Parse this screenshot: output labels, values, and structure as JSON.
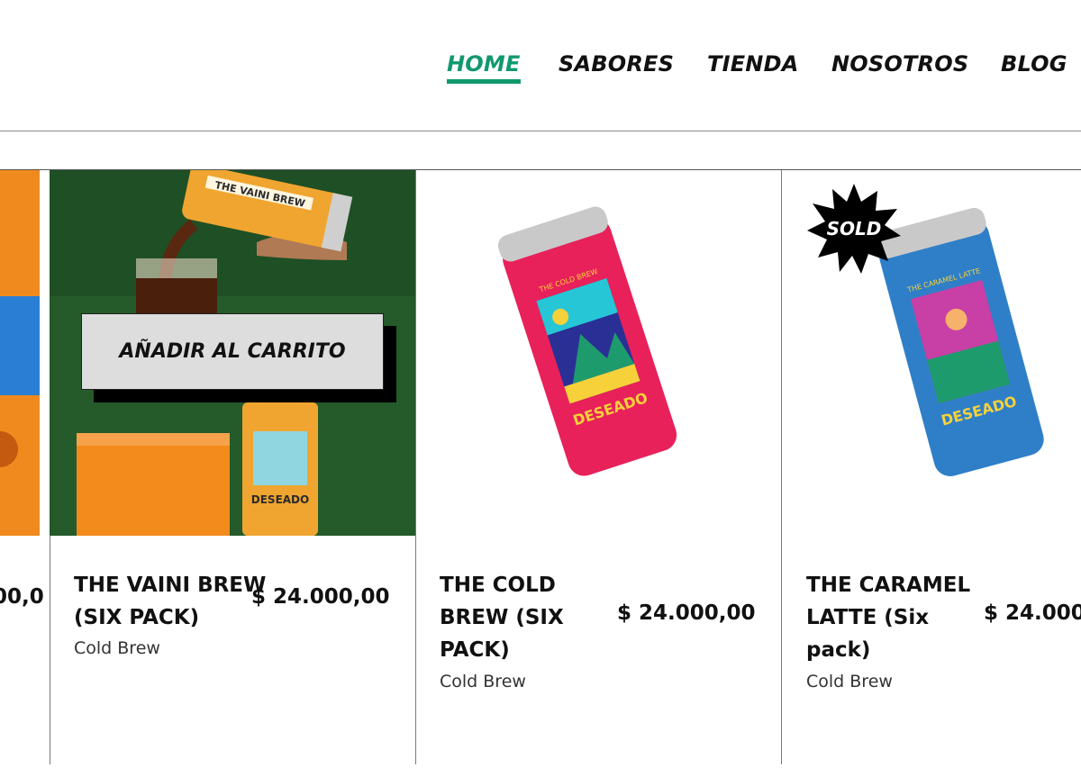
{
  "nav": {
    "items": [
      {
        "label": "HOME"
      },
      {
        "label": "SABORES"
      },
      {
        "label": "TIENDA"
      },
      {
        "label": "NOSOTROS"
      },
      {
        "label": "BLOG"
      }
    ],
    "active_color": "#11996e"
  },
  "products": [
    {
      "price_partial": "00,0"
    },
    {
      "title_lines": [
        "THE VAINI BREW",
        "(SIX PACK)"
      ],
      "price": "$  24.000,00",
      "category": "Cold Brew",
      "cart_label": "AÑADIR AL CARRITO",
      "can_label": "THE VAINI BREW",
      "can_brand": "DESEADO"
    },
    {
      "title_lines": [
        "THE COLD",
        "BREW (SIX",
        "PACK)"
      ],
      "price": "$  24.000,00",
      "category": "Cold Brew",
      "can_label": "THE COLD BREW",
      "can_brand": "DESEADO",
      "can_color": "#e8215a"
    },
    {
      "title_lines": [
        "THE CARAMEL",
        "LATTE (Six",
        "pack)"
      ],
      "price": "$  24.000",
      "category": "Cold Brew",
      "badge": "SOLD",
      "can_label": "THE CARAMEL LATTE",
      "can_brand": "DESEADO",
      "can_color": "#2f7fc8"
    }
  ]
}
